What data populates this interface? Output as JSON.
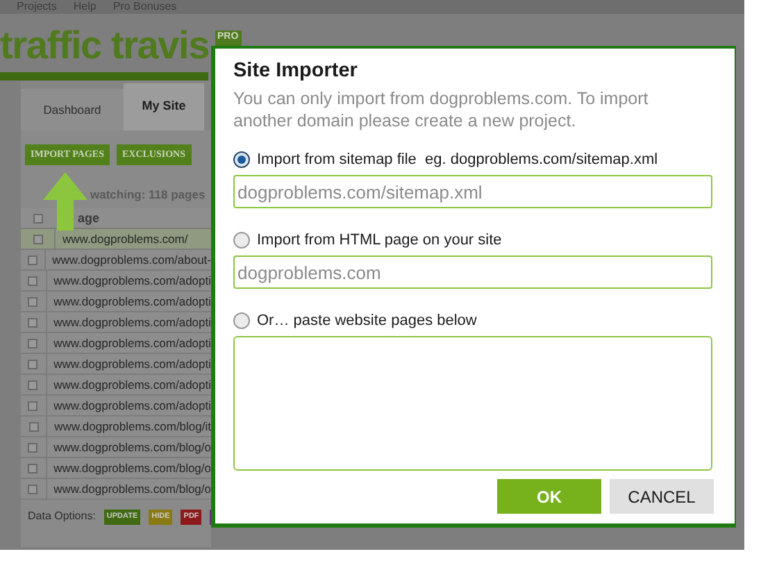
{
  "menu": [
    "Projects",
    "Help",
    "Pro Bonuses"
  ],
  "logo": {
    "text": "traffic travis",
    "badge": "PRO"
  },
  "tabs": [
    {
      "label": "Dashboard",
      "selected": false
    },
    {
      "label": "My Site",
      "selected": true
    }
  ],
  "toolbar": [
    "IMPORT PAGES",
    "EXCLUSIONS"
  ],
  "watch_summary": "watching: 118 pages",
  "table": {
    "columns": [
      "age"
    ],
    "select_all_checked": false,
    "rows": [
      {
        "page": "www.dogproblems.com/",
        "checked": false,
        "selected": true
      },
      {
        "page": "www.dogproblems.com/about-",
        "checked": false,
        "selected": false
      },
      {
        "page": "www.dogproblems.com/adopti",
        "checked": false,
        "selected": false
      },
      {
        "page": "www.dogproblems.com/adopti",
        "checked": false,
        "selected": false
      },
      {
        "page": "www.dogproblems.com/adopti",
        "checked": false,
        "selected": false
      },
      {
        "page": "www.dogproblems.com/adopti",
        "checked": false,
        "selected": false
      },
      {
        "page": "www.dogproblems.com/adopti",
        "checked": false,
        "selected": false
      },
      {
        "page": "www.dogproblems.com/adopti",
        "checked": false,
        "selected": false
      },
      {
        "page": "www.dogproblems.com/adopti",
        "checked": false,
        "selected": false
      },
      {
        "page": "www.dogproblems.com/blog/it",
        "checked": false,
        "selected": false
      },
      {
        "page": "www.dogproblems.com/blog/o",
        "checked": false,
        "selected": false
      },
      {
        "page": "www.dogproblems.com/blog/o",
        "checked": false,
        "selected": false
      },
      {
        "page": "www.dogproblems.com/blog/o",
        "checked": false,
        "selected": false
      }
    ]
  },
  "data_options": {
    "label": "Data Options:",
    "buttons": [
      {
        "label": "UPDATE",
        "color": "#3f6a12"
      },
      {
        "label": "HIDE",
        "color": "#8a7a14"
      },
      {
        "label": "PDF",
        "color": "#8c1a1a"
      },
      {
        "color": "#6a2a80"
      }
    ]
  },
  "dialog": {
    "title": "Site Importer",
    "description": "You can only import from dogproblems.com. To import another domain please create a new project.",
    "options": [
      {
        "label": "Import from sitemap file  eg. dogproblems.com/sitemap.xml",
        "selected": true,
        "kind": "input",
        "placeholder": "dogproblems.com/sitemap.xml"
      },
      {
        "label": "Import from HTML page on your site",
        "selected": false,
        "kind": "input",
        "placeholder": "dogproblems.com"
      },
      {
        "label": "Or… paste website pages below",
        "selected": false,
        "kind": "textarea"
      }
    ],
    "buttons": [
      {
        "label": "OK",
        "kind": "primary"
      },
      {
        "label": "CANCEL",
        "kind": "secondary"
      }
    ]
  }
}
